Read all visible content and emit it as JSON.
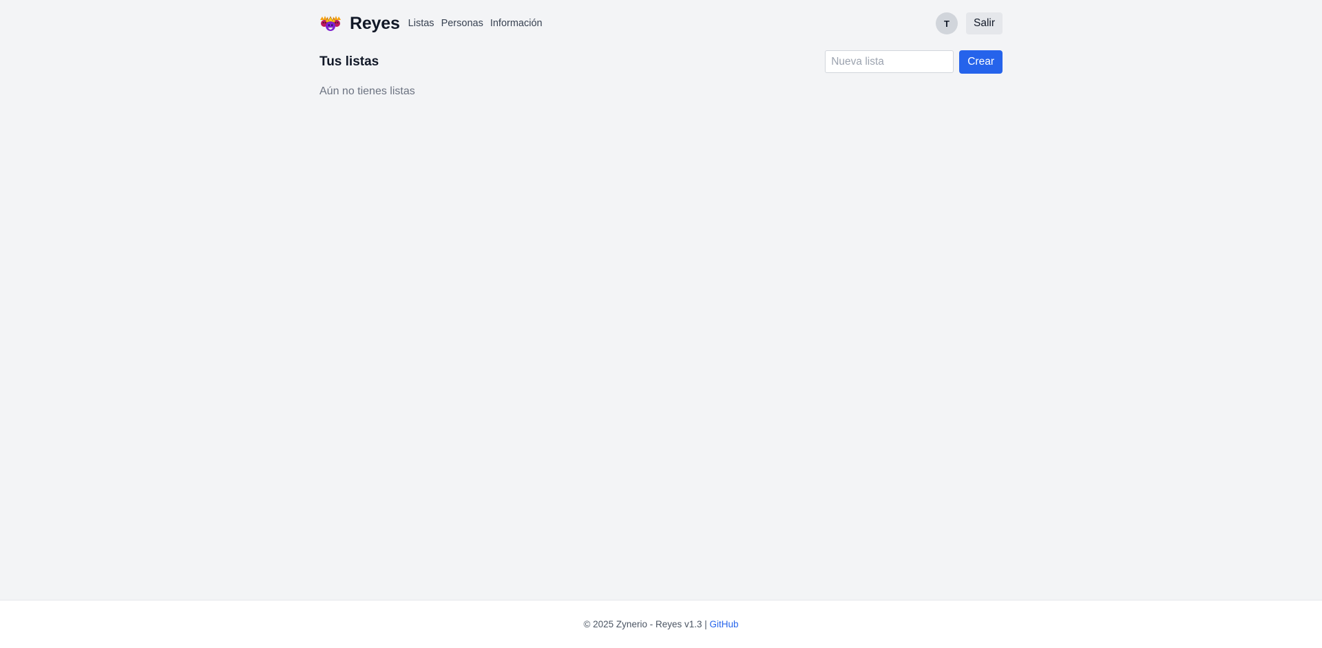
{
  "header": {
    "logo_icon": "three-kings-crown-icon",
    "brand": "Reyes",
    "nav": {
      "lists": "Listas",
      "people": "Personas",
      "info": "Información"
    },
    "user_initial": "T",
    "logout_label": "Salir"
  },
  "lists": {
    "title": "Tus listas",
    "input_placeholder": "Nueva lista",
    "input_value": "",
    "create_label": "Crear",
    "empty_message": "Aún no tienes listas"
  },
  "footer": {
    "text": "© 2025 Zynerio - Reyes v1.3 |",
    "link_label": "GitHub"
  },
  "colors": {
    "background": "#f3f4f6",
    "primary": "#2563eb",
    "footer_background": "#ffffff"
  }
}
